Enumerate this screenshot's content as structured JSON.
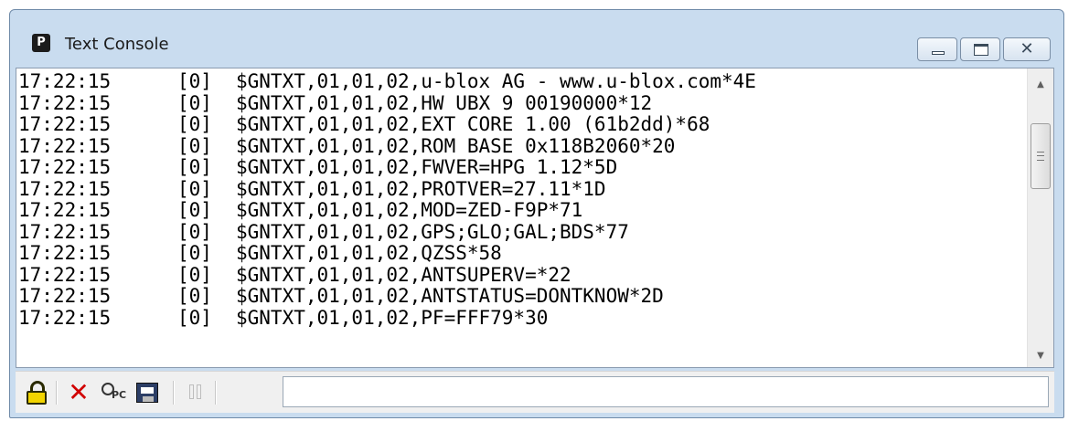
{
  "window": {
    "title": "Text Console"
  },
  "console": {
    "lines": [
      {
        "time": "17:22:15",
        "channel": "[0]",
        "message": "$GNTXT,01,01,02,u-blox AG - www.u-blox.com*4E"
      },
      {
        "time": "17:22:15",
        "channel": "[0]",
        "message": "$GNTXT,01,01,02,HW UBX 9 00190000*12"
      },
      {
        "time": "17:22:15",
        "channel": "[0]",
        "message": "$GNTXT,01,01,02,EXT CORE 1.00 (61b2dd)*68"
      },
      {
        "time": "17:22:15",
        "channel": "[0]",
        "message": "$GNTXT,01,01,02,ROM BASE 0x118B2060*20"
      },
      {
        "time": "17:22:15",
        "channel": "[0]",
        "message": "$GNTXT,01,01,02,FWVER=HPG 1.12*5D"
      },
      {
        "time": "17:22:15",
        "channel": "[0]",
        "message": "$GNTXT,01,01,02,PROTVER=27.11*1D"
      },
      {
        "time": "17:22:15",
        "channel": "[0]",
        "message": "$GNTXT,01,01,02,MOD=ZED-F9P*71"
      },
      {
        "time": "17:22:15",
        "channel": "[0]",
        "message": "$GNTXT,01,01,02,GPS;GLO;GAL;BDS*77"
      },
      {
        "time": "17:22:15",
        "channel": "[0]",
        "message": "$GNTXT,01,01,02,QZSS*58"
      },
      {
        "time": "17:22:15",
        "channel": "[0]",
        "message": "$GNTXT,01,01,02,ANTSUPERV=*22"
      },
      {
        "time": "17:22:15",
        "channel": "[0]",
        "message": "$GNTXT,01,01,02,ANTSTATUS=DONTKNOW*2D"
      },
      {
        "time": "17:22:15",
        "channel": "[0]",
        "message": "$GNTXT,01,01,02,PF=FFF79*30"
      }
    ]
  },
  "toolbar": {
    "icons": [
      "lock-icon",
      "clear-icon",
      "pc-time-icon",
      "save-icon",
      "pause-icon"
    ],
    "pc_label": "PC",
    "command_value": ""
  },
  "colors": {
    "clear": "#d10000",
    "lock": "#f2d400",
    "frame": "#c9dcef"
  }
}
